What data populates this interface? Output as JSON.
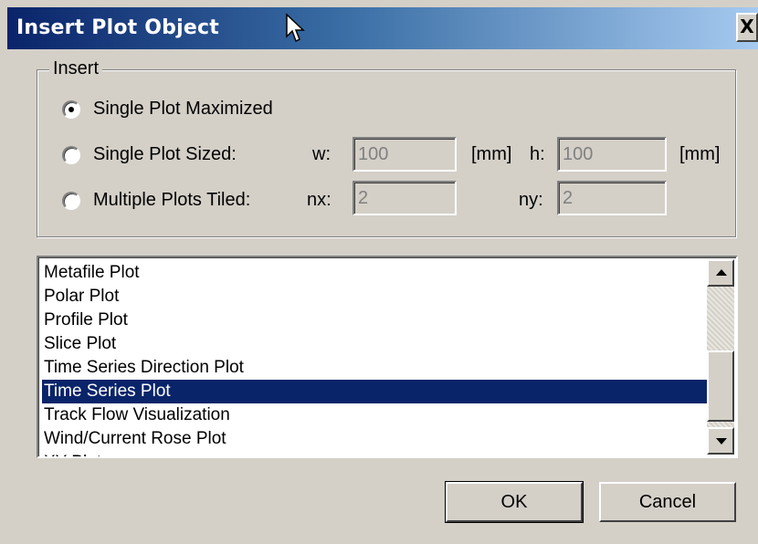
{
  "window": {
    "title": "Insert Plot Object",
    "close_label": "X"
  },
  "insert_group": {
    "legend": "Insert",
    "options": {
      "maximized": "Single Plot Maximized",
      "sized": "Single Plot Sized:",
      "tiled": "Multiple Plots Tiled:"
    },
    "selected": "maximized",
    "w_label": "w:",
    "w_value": "100",
    "w_unit": "[mm]",
    "h_label": "h:",
    "h_value": "100",
    "h_unit": "[mm]",
    "nx_label": "nx:",
    "nx_value": "2",
    "ny_label": "ny:",
    "ny_value": "2"
  },
  "plot_list": {
    "items": [
      "Metafile Plot",
      "Polar Plot",
      "Profile Plot",
      "Slice Plot",
      "Time Series Direction Plot",
      "Time Series Plot",
      "Track Flow Visualization",
      "Wind/Current Rose Plot",
      "XY Plot"
    ],
    "selected_index": 5
  },
  "buttons": {
    "ok": "OK",
    "cancel": "Cancel"
  },
  "colors": {
    "title_start": "#0a246a",
    "title_end": "#a6caf0",
    "selection": "#0a246a",
    "face": "#d4d0c8"
  }
}
